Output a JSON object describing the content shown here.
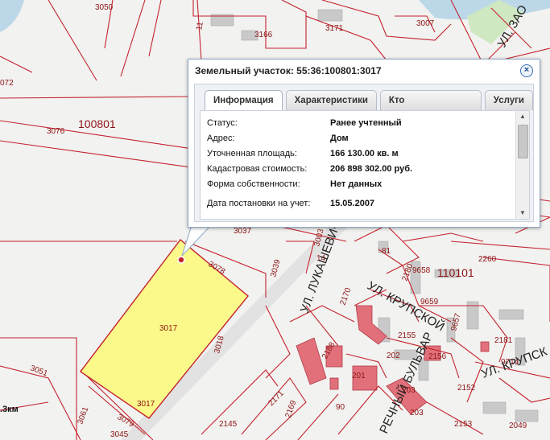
{
  "popup": {
    "title": "Земельный участок: 55:36:100801:3017",
    "close_label": "×",
    "tabs": [
      {
        "label": "Информация",
        "active": true
      },
      {
        "label": "Характеристики",
        "active": false
      },
      {
        "label": "Кто обслуживает?",
        "active": false
      },
      {
        "label": "Услуги",
        "active": false
      }
    ],
    "rows": [
      {
        "key": "Статус:",
        "value": "Ранее учтенный"
      },
      {
        "key": "Адрес:",
        "value": "Дом"
      },
      {
        "key": "Уточненная площадь:",
        "value": "166 130.00 кв. м"
      },
      {
        "key": "Кадастровая стоимость:",
        "value": "206 898 302.00 руб."
      },
      {
        "key": "Форма собственности:",
        "value": "Нет данных"
      },
      {
        "key": "Дата постановки на учет:",
        "value": "15.05.2007"
      }
    ]
  },
  "map": {
    "parcel_labels": [
      "3050",
      "3166",
      "3171",
      "3007",
      "072",
      "3076",
      "3037",
      "3003",
      "3078",
      "3039",
      "3017",
      "3017",
      "3018",
      "3051",
      "3061",
      "3079",
      "3045",
      "2145",
      "2171",
      "2169",
      "2188",
      "2170",
      "2155",
      "2156",
      "2152",
      "2153",
      "2181",
      "9714",
      "9657",
      "9659",
      "9658",
      "2180",
      "2260",
      "2049",
      "202",
      "201",
      "203",
      "203",
      "81",
      "14",
      "90",
      "11"
    ],
    "quarter_labels": [
      "100801",
      "110101"
    ],
    "street_labels": [
      "УЛ. ЛУКАШЕВИЧА",
      "УЛ. КРУПСКОЙ",
      "УЛ. КРУПСК",
      "РЕЧНЫЙ БУЛЬВАР",
      "УЛ. ЗАО"
    ],
    "scale_text": ".3км"
  }
}
